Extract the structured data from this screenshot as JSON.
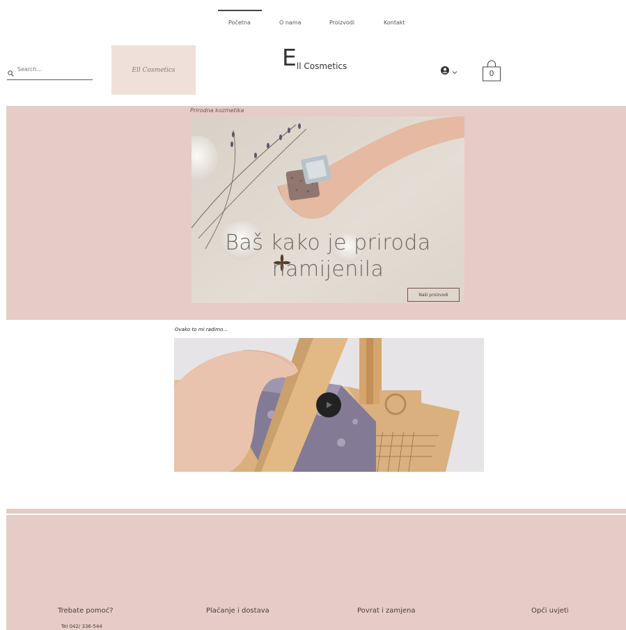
{
  "nav": {
    "items": [
      {
        "label": "Početna",
        "active": true
      },
      {
        "label": "O nama",
        "active": false
      },
      {
        "label": "Proizvodi",
        "active": false
      },
      {
        "label": "Kontakt",
        "active": false
      }
    ]
  },
  "header": {
    "search_placeholder": "Search...",
    "logo_text": "Ell Cosmetics",
    "title_initial": "E",
    "title_rest": "ll Cosmetics",
    "cart_count": "0"
  },
  "hero": {
    "caption": "Prirodna kozmetika",
    "heading": "Baš kako je priroda namijenila",
    "button_label": "Naši proizvodi"
  },
  "video": {
    "caption": "Ovako to mi radimo..."
  },
  "footer": {
    "help_title": "Trebate pomoć?",
    "phone": "Tel 042/ 336-544",
    "links": {
      "payment": "Plaćanje i dostava",
      "returns": "Povrat i zamjena",
      "terms": "Opći uvjeti"
    }
  },
  "colors": {
    "section_bg": "#e7cbc6",
    "logo_bg": "#efe0d9",
    "button_border": "#7a4d47"
  },
  "icons": [
    "search-icon",
    "account-icon",
    "chevron-down-icon",
    "cart-icon",
    "play-icon"
  ]
}
